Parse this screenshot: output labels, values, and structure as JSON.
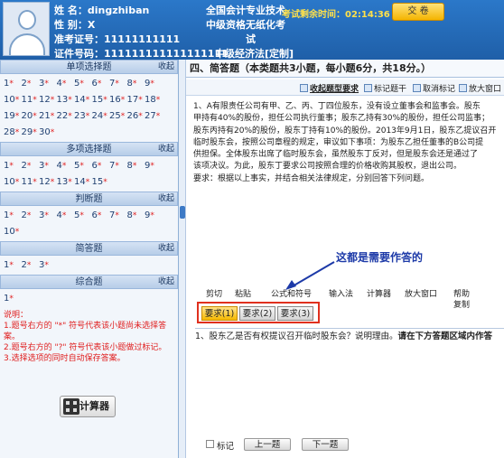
{
  "header": {
    "name_label": "姓 名：",
    "name": "dingzhiban",
    "gender_label": "性 别：",
    "gender": "X",
    "ticket_label": "准考证号：",
    "ticket": "11111111111",
    "id_label": "证件号码：",
    "id": "111111111111111111",
    "exam_line1": "全国会计专业技术",
    "exam_line2": "中级资格无纸化考",
    "exam_line3": "试",
    "subject": "中级经济法[定制]",
    "timer": "考试剩余时间：02:14:36",
    "submit": "交 卷"
  },
  "left": {
    "collapse": "收起",
    "sections": [
      {
        "title": "单项选择题",
        "questions": [
          "1",
          "2",
          "3",
          "4",
          "5",
          "6",
          "7",
          "8",
          "9",
          "10",
          "11",
          "12",
          "13",
          "14",
          "15",
          "16",
          "17",
          "18",
          "19",
          "20",
          "21",
          "22",
          "23",
          "24",
          "25",
          "26",
          "27",
          "28",
          "29",
          "30"
        ]
      },
      {
        "title": "多项选择题",
        "questions": [
          "1",
          "2",
          "3",
          "4",
          "5",
          "6",
          "7",
          "8",
          "9",
          "10",
          "11",
          "12",
          "13",
          "14",
          "15"
        ]
      },
      {
        "title": "判断题",
        "questions": [
          "1",
          "2",
          "3",
          "4",
          "5",
          "6",
          "7",
          "8",
          "9",
          "10"
        ]
      },
      {
        "title": "简答题",
        "questions": [
          "1",
          "2",
          "3"
        ]
      },
      {
        "title": "综合题",
        "questions": [
          "1"
        ]
      }
    ],
    "star": "*",
    "notes": [
      "说明：",
      "1.题号右方的 \"*\" 符号代表该小题尚未选择答案。",
      "2.题号右方的 \"?\" 符号代表该小题做过标记。",
      "3.选择选项的同时自动保存答案。"
    ],
    "calculator": "计算器"
  },
  "main": {
    "title": "四、简答题（本类题共3小题，每小题6分，共18分。）",
    "toolbar": {
      "collapse_req": "收起题型要求",
      "mark": "标记题干",
      "unmark": "取消标记",
      "zoom": "放大窗口"
    },
    "question_lines": [
      "1、A有限责任公司有甲、乙、丙、丁四位股东，没有设立董事会和监事会。股东",
      "甲持有40%的股份，担任公司执行董事；股东乙持有30%的股份，担任公司监事；",
      "股东丙持有20%的股份，股东丁持有10%的股份。2013年9月1日，股东乙提议召开",
      "临时股东会，按照公司章程的规定，审议如下事项：为股东乙担任董事的B公司提",
      "供担保。全体股东出席了临时股东会，虽然股东丁反对，但是股东会还是通过了",
      "该项决议。为此，股东丁要求公司按照合理的价格收购其股权，退出公司。",
      "要求：根据以上事实，并结合相关法律规定，分别回答下列问题。"
    ],
    "annotation": "这都是需要作答的",
    "editor_toolbar": {
      "cut": "剪切",
      "paste": "粘贴",
      "formula": "公式和符号",
      "input": "输入法",
      "calculator": "计算器",
      "zoom": "放大窗口",
      "help": "帮助",
      "copy": "复制"
    },
    "tabs": [
      "要求(1)",
      "要求(2)",
      "要求(3)"
    ],
    "answer_question": "1、股东乙是否有权提议召开临时股东会？说明理由。",
    "answer_hint": "请在下方答题区域内作答",
    "footer": {
      "mark": "标记",
      "prev": "上一题",
      "next": "下一题"
    }
  }
}
